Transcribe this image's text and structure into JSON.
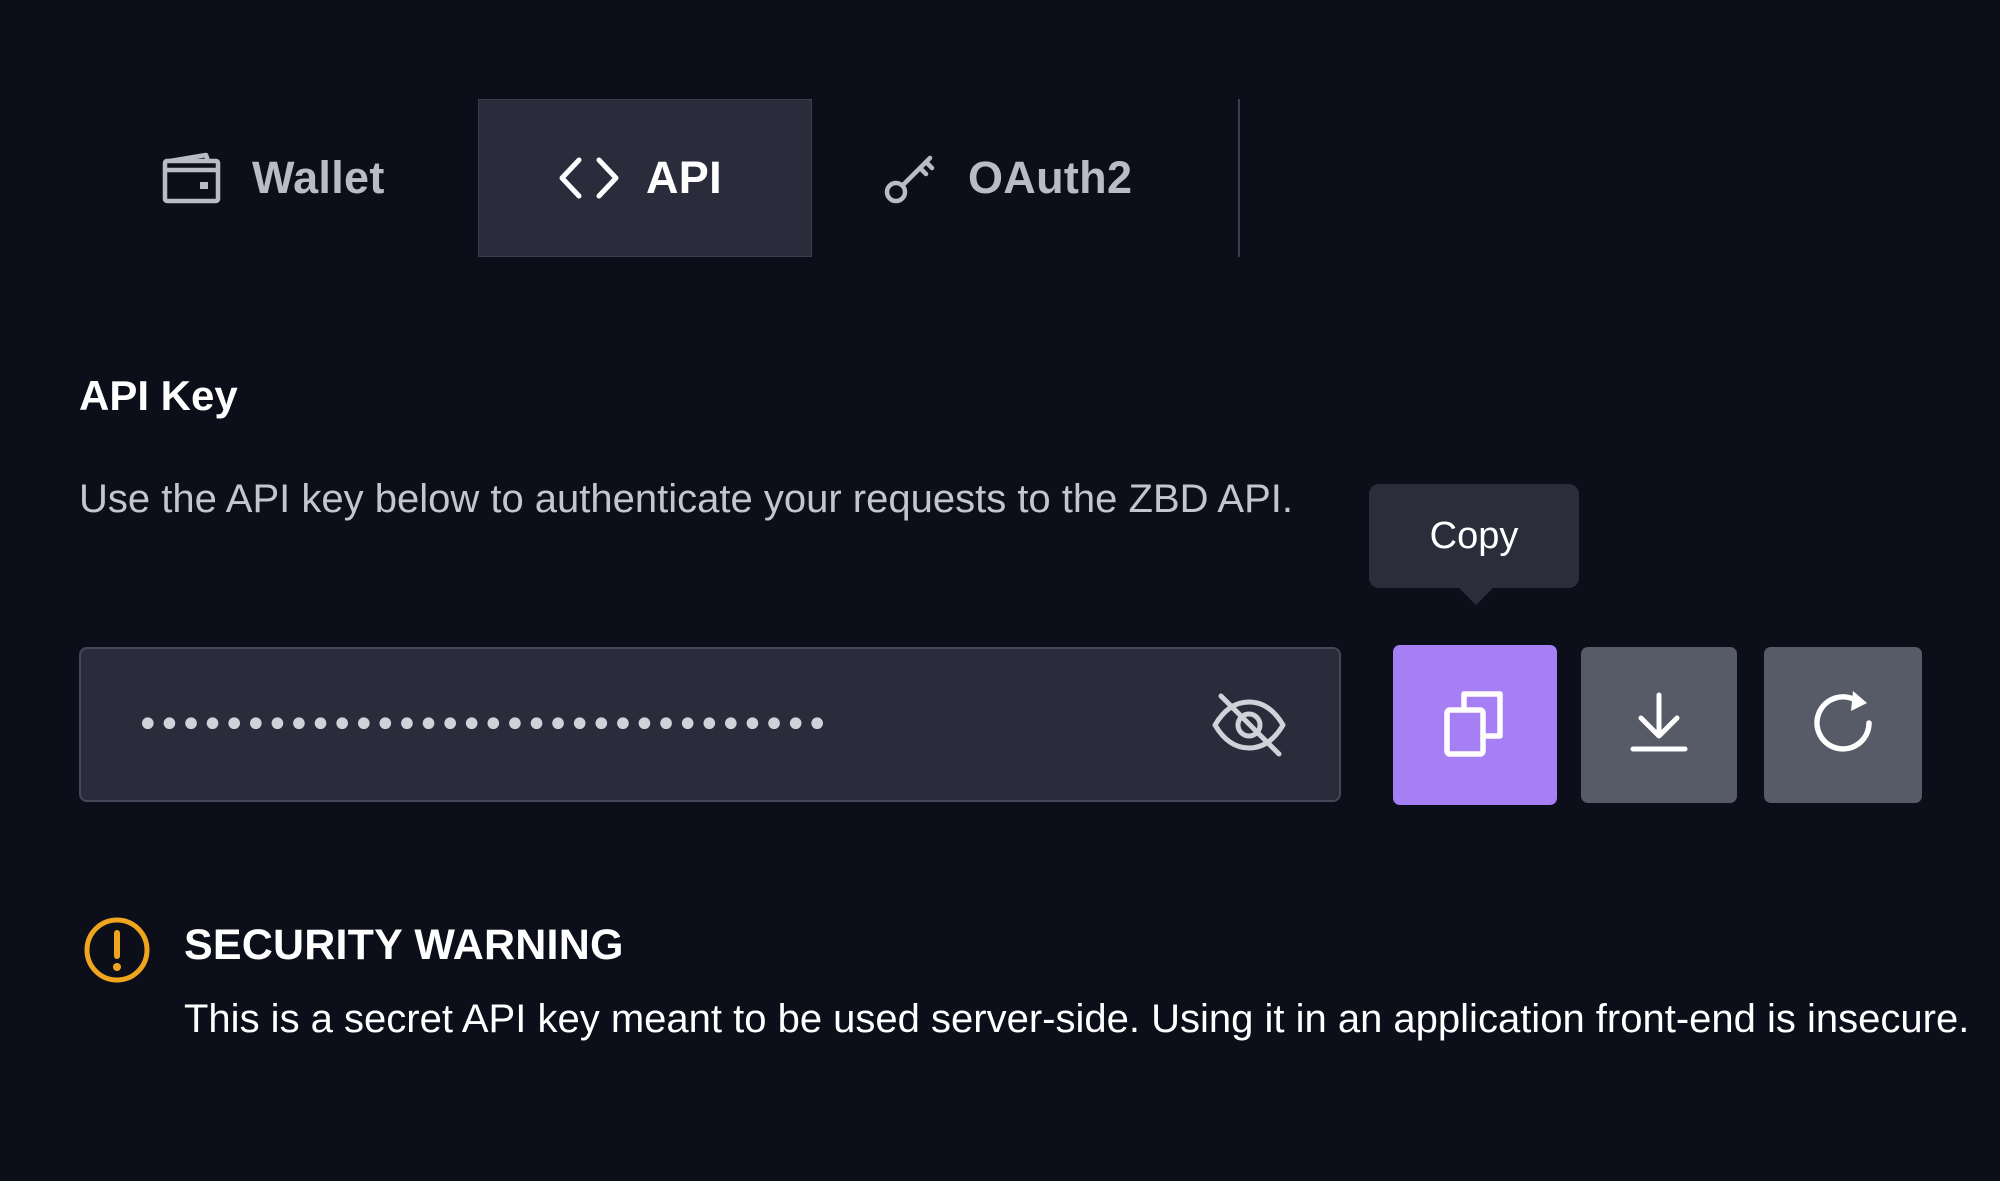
{
  "tabs": {
    "wallet": {
      "label": "Wallet",
      "icon": "wallet-icon"
    },
    "api": {
      "label": "API",
      "icon": "code-icon",
      "active": true
    },
    "oauth": {
      "label": "OAuth2",
      "icon": "key-icon"
    }
  },
  "api_key": {
    "title": "API Key",
    "description": "Use the API key below to authenticate your requests to the ZBD API.",
    "masked_value": "••••••••••••••••••••••••••••••••",
    "visibility_icon": "eye-off-icon"
  },
  "actions": {
    "copy": {
      "icon": "copy-icon",
      "tooltip": "Copy"
    },
    "download": {
      "icon": "download-icon"
    },
    "regenerate": {
      "icon": "refresh-icon"
    }
  },
  "warning": {
    "icon": "alert-circle-icon",
    "title": "SECURITY WARNING",
    "text": "This is a secret API key meant to be used server-side. Using it in an application front-end is insecure."
  },
  "colors": {
    "background": "#0c0e1a",
    "active_tab": "#2a2c3b",
    "accent": "#a77ff5",
    "secondary_button": "#575a67",
    "warning": "#f0a51f"
  }
}
